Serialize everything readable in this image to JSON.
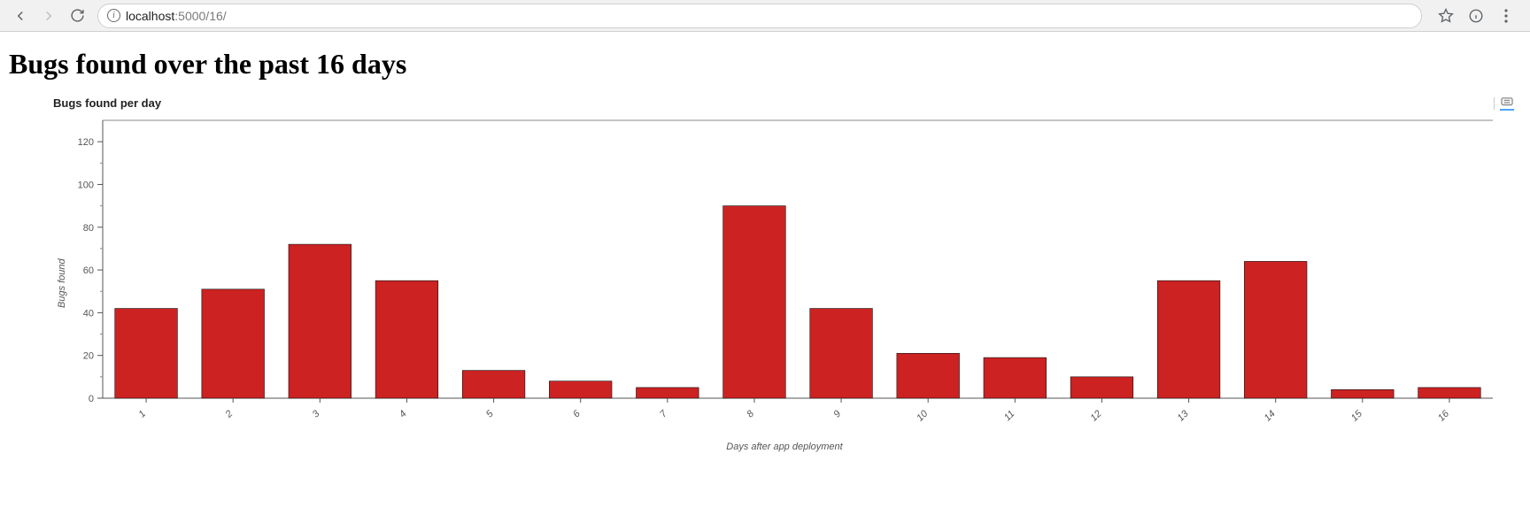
{
  "browser": {
    "url_host": "localhost",
    "url_rest": ":5000/16/"
  },
  "page": {
    "title": "Bugs found over the past 16 days"
  },
  "chart_data": {
    "type": "bar",
    "title": "Bugs found per day",
    "xlabel": "Days after app deployment",
    "ylabel": "Bugs found",
    "categories": [
      "1",
      "2",
      "3",
      "4",
      "5",
      "6",
      "7",
      "8",
      "9",
      "10",
      "11",
      "12",
      "13",
      "14",
      "15",
      "16"
    ],
    "values": [
      42,
      51,
      72,
      55,
      13,
      8,
      5,
      90,
      42,
      21,
      19,
      10,
      55,
      64,
      4,
      5
    ],
    "yticks": [
      0,
      20,
      40,
      60,
      80,
      100,
      120
    ],
    "ylim": [
      0,
      130
    ],
    "bar_color": "#cc2222"
  }
}
